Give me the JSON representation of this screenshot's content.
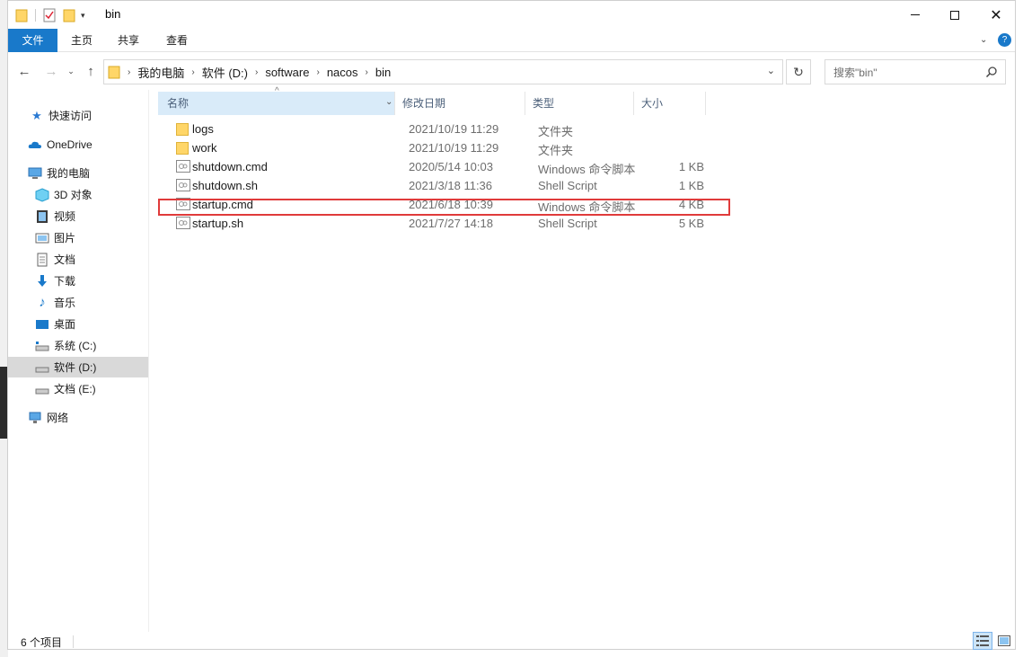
{
  "window": {
    "title": "bin"
  },
  "ribbon": {
    "tabs": [
      "文件",
      "主页",
      "共享",
      "查看"
    ],
    "help_icon": "help-icon"
  },
  "address": {
    "breadcrumbs": [
      "我的电脑",
      "软件 (D:)",
      "software",
      "nacos",
      "bin"
    ]
  },
  "search": {
    "placeholder": "搜索\"bin\""
  },
  "nav": {
    "items": [
      {
        "label": "快速访问",
        "icon": "star-icon"
      },
      {
        "label": "OneDrive",
        "icon": "cloud-icon"
      },
      {
        "label": "我的电脑",
        "icon": "computer-icon"
      },
      {
        "label": "3D 对象",
        "icon": "cube-icon"
      },
      {
        "label": "视频",
        "icon": "video-icon"
      },
      {
        "label": "图片",
        "icon": "picture-icon"
      },
      {
        "label": "文档",
        "icon": "document-icon"
      },
      {
        "label": "下载",
        "icon": "download-icon"
      },
      {
        "label": "音乐",
        "icon": "music-icon"
      },
      {
        "label": "桌面",
        "icon": "desktop-icon"
      },
      {
        "label": "系统 (C:)",
        "icon": "drive-icon"
      },
      {
        "label": "软件 (D:)",
        "icon": "drive-icon",
        "selected": true
      },
      {
        "label": "文档 (E:)",
        "icon": "drive-icon"
      },
      {
        "label": "网络",
        "icon": "network-icon"
      }
    ]
  },
  "columns": {
    "name": "名称",
    "date": "修改日期",
    "type": "类型",
    "size": "大小"
  },
  "files": [
    {
      "name": "logs",
      "date": "2021/10/19 11:29",
      "type": "文件夹",
      "size": "",
      "icon": "folder-icon"
    },
    {
      "name": "work",
      "date": "2021/10/19 11:29",
      "type": "文件夹",
      "size": "",
      "icon": "folder-icon"
    },
    {
      "name": "shutdown.cmd",
      "date": "2020/5/14 10:03",
      "type": "Windows 命令脚本",
      "size": "1 KB",
      "icon": "script-icon"
    },
    {
      "name": "shutdown.sh",
      "date": "2021/3/18 11:36",
      "type": "Shell Script",
      "size": "1 KB",
      "icon": "script-icon"
    },
    {
      "name": "startup.cmd",
      "date": "2021/6/18 10:39",
      "type": "Windows 命令脚本",
      "size": "4 KB",
      "icon": "script-icon"
    },
    {
      "name": "startup.sh",
      "date": "2021/7/27 14:18",
      "type": "Shell Script",
      "size": "5 KB",
      "icon": "script-icon"
    }
  ],
  "status": {
    "count": "6 个项目"
  },
  "colors": {
    "accent": "#1979ca",
    "highlight": "#e03b3b",
    "folder": "#ffd668",
    "selected_header": "#d9ebf9"
  }
}
